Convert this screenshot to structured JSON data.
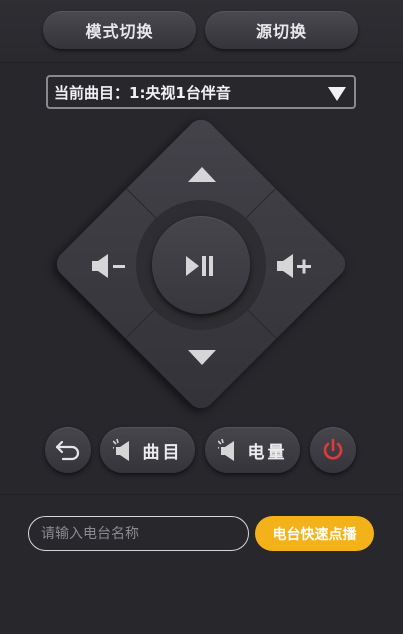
{
  "header": {
    "mode_button": "模式切换",
    "source_button": "源切换"
  },
  "current_track": {
    "label": "当前曲目：1:央视1台伴音"
  },
  "dpad": {
    "up": "up-arrow-icon",
    "down": "down-arrow-icon",
    "left": "volume-down-icon",
    "right": "volume-up-icon",
    "center": "play-pause-icon"
  },
  "controls": {
    "back_icon": "back-icon",
    "song_label": "曲目",
    "station_label": "电量",
    "power_icon": "power-icon"
  },
  "search": {
    "placeholder": "请输入电台名称",
    "value": "",
    "quick_button": "电台快速点播"
  },
  "colors": {
    "accent": "#f3b21a",
    "power": "#e03b3b",
    "background": "#28272c"
  }
}
